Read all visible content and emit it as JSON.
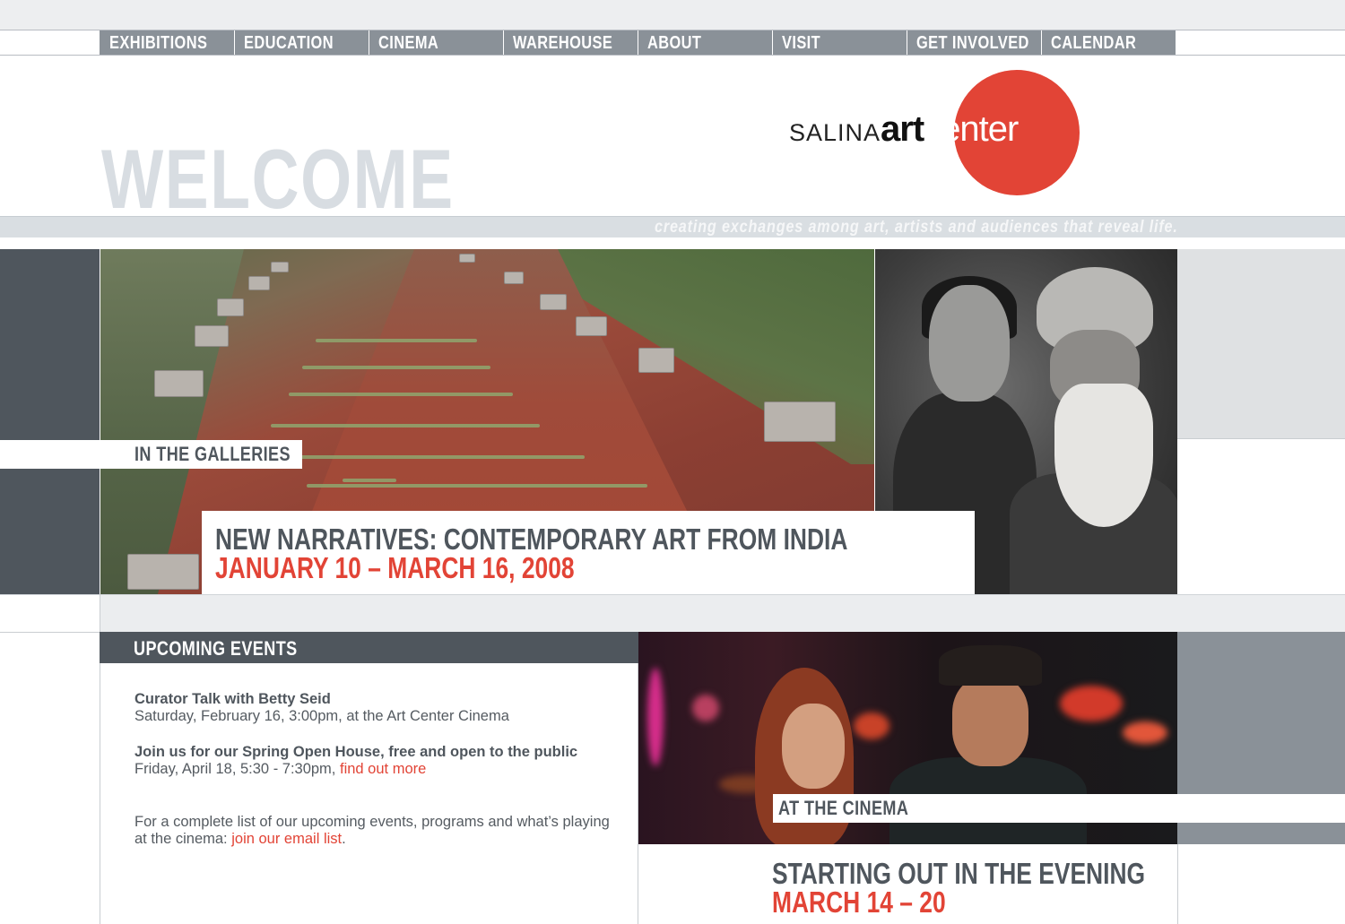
{
  "nav": {
    "items": [
      {
        "label": "EXHIBITIONS"
      },
      {
        "label": "EDUCATION"
      },
      {
        "label": "CINEMA"
      },
      {
        "label": "WAREHOUSE"
      },
      {
        "label": "ABOUT"
      },
      {
        "label": "VISIT"
      },
      {
        "label": "GET INVOLVED"
      },
      {
        "label": "CALENDAR"
      }
    ]
  },
  "header": {
    "welcome": "WELCOME",
    "logo": {
      "salina": "SALINA",
      "art": "art",
      "center": "center"
    },
    "tagline": "creating exchanges among art, artists and audiences that reveal life."
  },
  "galleries": {
    "label": "IN THE GALLERIES",
    "title": "NEW NARRATIVES: CONTEMPORARY ART FROM INDIA",
    "dates": "JANUARY 10 – MARCH 16, 2008"
  },
  "events": {
    "heading": "UPCOMING EVENTS",
    "items": [
      {
        "title": "Curator Talk with Betty Seid",
        "detail": "Saturday, February 16, 3:00pm, at the Art Center Cinema"
      },
      {
        "title": "Join us for our Spring Open House, free and open to the public",
        "detail": "Friday, April 18, 5:30 - 7:30pm, ",
        "link": "find out more"
      }
    ],
    "footer_text": "For a complete list of our upcoming events, programs and what’s playing at the cinema: ",
    "footer_link": "join our email list",
    "footer_end": "."
  },
  "cinema": {
    "label": "AT THE CINEMA",
    "title": "STARTING OUT IN THE EVENING",
    "dates": "MARCH 14 – 20"
  },
  "colors": {
    "accent": "#e24436",
    "nav_bg": "#8a9198",
    "dark_slate": "#4f565d",
    "welcome": "#d8dde2"
  }
}
